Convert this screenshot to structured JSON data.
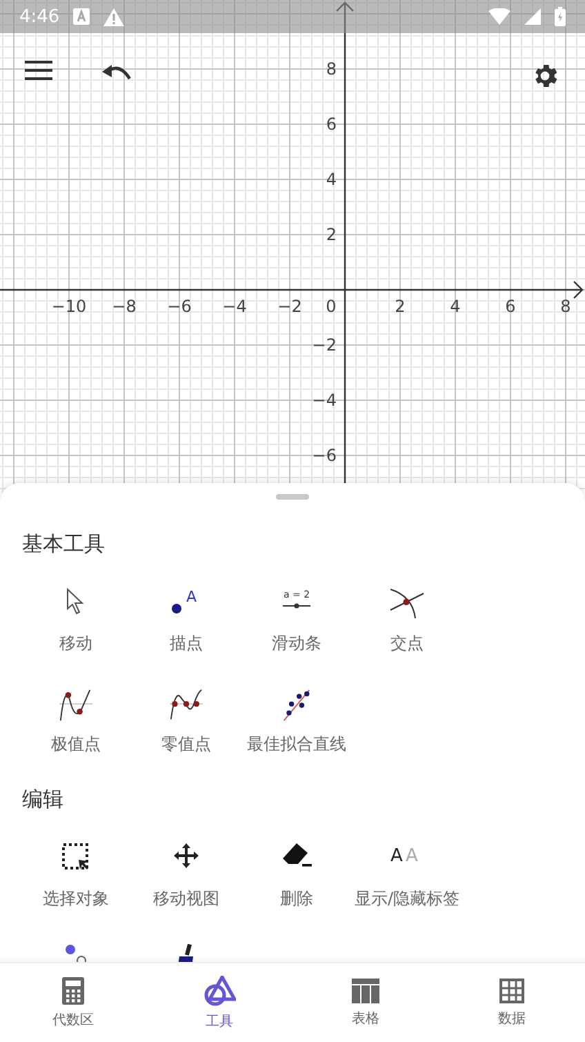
{
  "status_bar": {
    "time": "4:46"
  },
  "graph": {
    "x_labels": [
      "−10",
      "−8",
      "−6",
      "−4",
      "−2",
      "0",
      "2",
      "4",
      "6",
      "8"
    ],
    "y_labels": [
      "8",
      "6",
      "4",
      "2",
      "−2",
      "−4",
      "−6"
    ]
  },
  "sections": [
    {
      "title": "基本工具",
      "tools": [
        {
          "kind": "move",
          "label": "移动"
        },
        {
          "kind": "point",
          "label": "描点",
          "glyph": "A"
        },
        {
          "kind": "slider",
          "label": "滑动条",
          "glyph": "a = 2"
        },
        {
          "kind": "intersect",
          "label": "交点"
        },
        {
          "kind": "extremum",
          "label": "极值点"
        },
        {
          "kind": "roots",
          "label": "零值点"
        },
        {
          "kind": "fit-line",
          "label": "最佳拟合直线"
        }
      ]
    },
    {
      "title": "编辑",
      "tools": [
        {
          "kind": "select",
          "label": "选择对象"
        },
        {
          "kind": "pan",
          "label": "移动视图"
        },
        {
          "kind": "delete",
          "label": "删除"
        },
        {
          "kind": "show-label",
          "label": "显示/隐藏标签",
          "glyphs": [
            "A",
            "A"
          ]
        },
        {
          "kind": "point-style"
        },
        {
          "kind": "brush"
        }
      ]
    }
  ],
  "nav": [
    {
      "kind": "calculator",
      "label": "代数区",
      "selected": false
    },
    {
      "kind": "tools",
      "label": "工具",
      "selected": true
    },
    {
      "kind": "table",
      "label": "表格",
      "selected": false
    },
    {
      "kind": "data",
      "label": "数据",
      "selected": false
    }
  ]
}
